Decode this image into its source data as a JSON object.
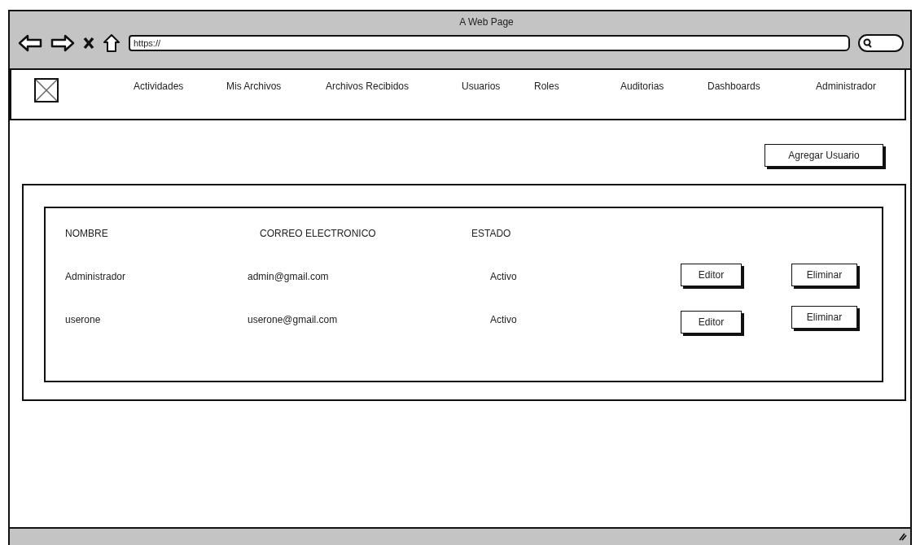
{
  "window": {
    "title": "A Web Page"
  },
  "address_bar": {
    "value": "https://"
  },
  "nav": {
    "items": [
      "Actividades",
      "Mis Archivos",
      "Archivos Recibidos",
      "Usuarios",
      "Roles",
      "Auditorias",
      "Dashboards",
      "Administrador"
    ]
  },
  "add_button": "Agregar Usuario",
  "table": {
    "columns": [
      "NOMBRE",
      "CORREO ELECTRONICO",
      "ESTADO"
    ],
    "rows": [
      {
        "cells": [
          "Administrador",
          "admin@gmail.com",
          "Activo"
        ],
        "actions": [
          "Editor",
          "Eliminar"
        ]
      },
      {
        "cells": [
          "userone",
          "userone@gmail.com",
          "Activo"
        ],
        "actions": [
          "Editor",
          "Eliminar"
        ]
      }
    ]
  }
}
